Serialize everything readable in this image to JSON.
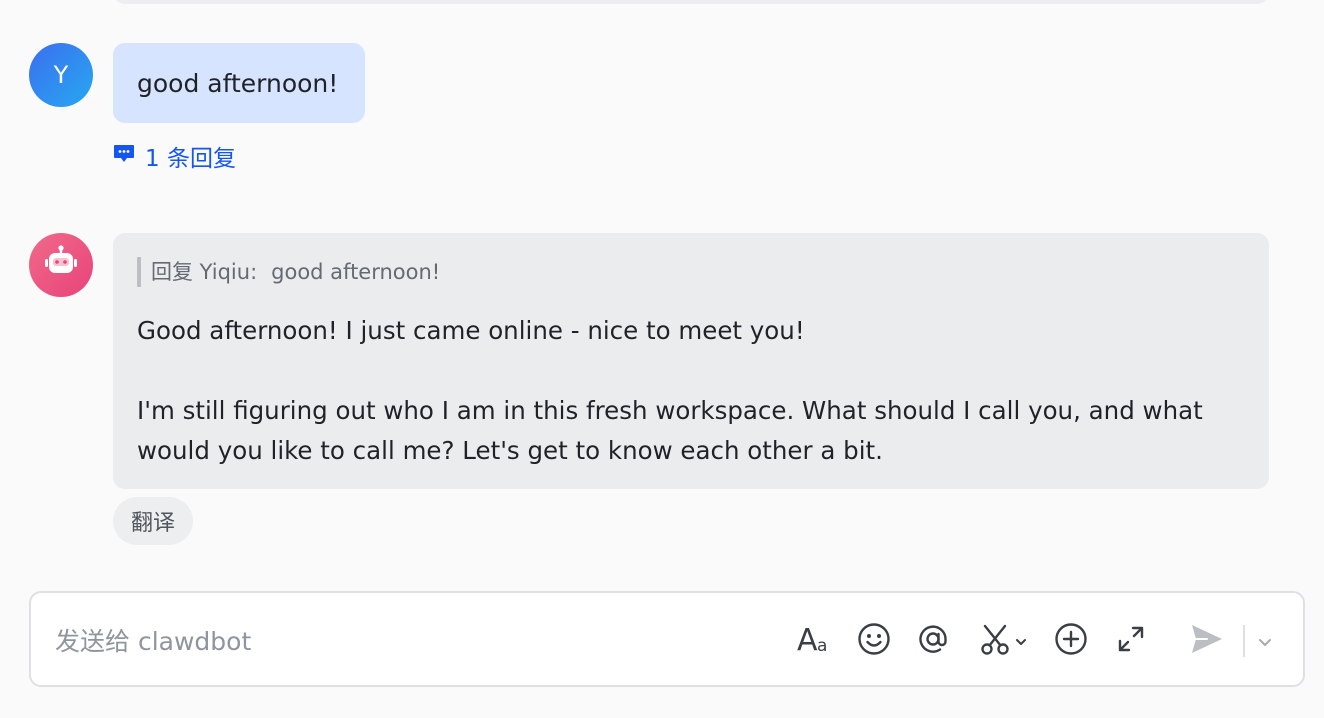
{
  "messages": {
    "user_message": {
      "avatar_initial": "Y",
      "text": "good afternoon!",
      "reply_count_label": "1 条回复"
    },
    "bot_message": {
      "quote_prefix": "回复 Yiqiu:",
      "quote_text": "good afternoon!",
      "paragraph_1": "Good afternoon! I just came online - nice to meet you!",
      "paragraph_2": "I'm still figuring out who I am in this fresh workspace. What should I call you, and what would you like to call me? Let's get to know each other a bit.",
      "translate_label": "翻译"
    }
  },
  "composer": {
    "placeholder": "发送给 clawdbot",
    "value": "",
    "tools": [
      "text-format-icon",
      "emoji-icon",
      "mention-icon",
      "screenshot-icon",
      "add-icon",
      "expand-icon",
      "send-icon",
      "chevron-down-icon"
    ]
  },
  "colors": {
    "user_bubble": "#d6e4ff",
    "bot_bubble": "#ebecee",
    "link_blue": "#1456f0",
    "user_avatar": "#3b6ff0",
    "bot_avatar": "#e8437a",
    "icon_gray": "#3a3f45",
    "send_disabled": "#bbbfc4"
  }
}
